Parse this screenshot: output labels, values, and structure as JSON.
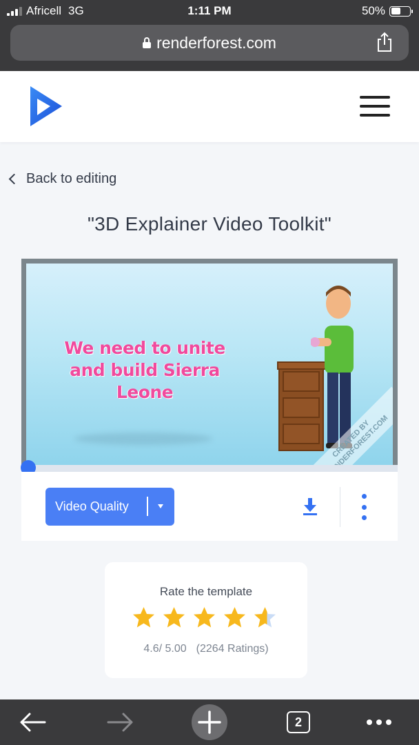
{
  "status_bar": {
    "carrier": "Africell",
    "network": "3G",
    "time": "1:11 PM",
    "battery": "50%",
    "battery_level": 0.5
  },
  "browser": {
    "url": "renderforest.com",
    "icons": [
      "lock-icon",
      "share-icon",
      "back-arrow-icon",
      "forward-arrow-icon",
      "new-tab-icon",
      "tabs-icon",
      "more-icon"
    ],
    "tab_count": "2"
  },
  "header": {
    "logo": "renderforest-logo",
    "menu_icon": "hamburger-menu-icon"
  },
  "nav": {
    "back_label": "Back to editing"
  },
  "page": {
    "title": "\"3D Explainer Video Toolkit\""
  },
  "video": {
    "overlay_text": "We need to unite and build Sierra Leone",
    "watermark": "CREATED BY RENDERFOREST.COM",
    "progress": 0.0
  },
  "controls": {
    "quality_label": "Video Quality",
    "download_icon": "download-icon",
    "more_icon": "vertical-dots-icon"
  },
  "rating": {
    "label": "Rate the template",
    "value": 4.6,
    "score_text": "4.6/ 5.00",
    "count_text": "(2264 Ratings)",
    "max_stars": 5
  },
  "colors": {
    "accent": "#3471f2",
    "button": "#4a7ff5",
    "star": "#f7b81d",
    "chrome": "#3a3a3c"
  }
}
